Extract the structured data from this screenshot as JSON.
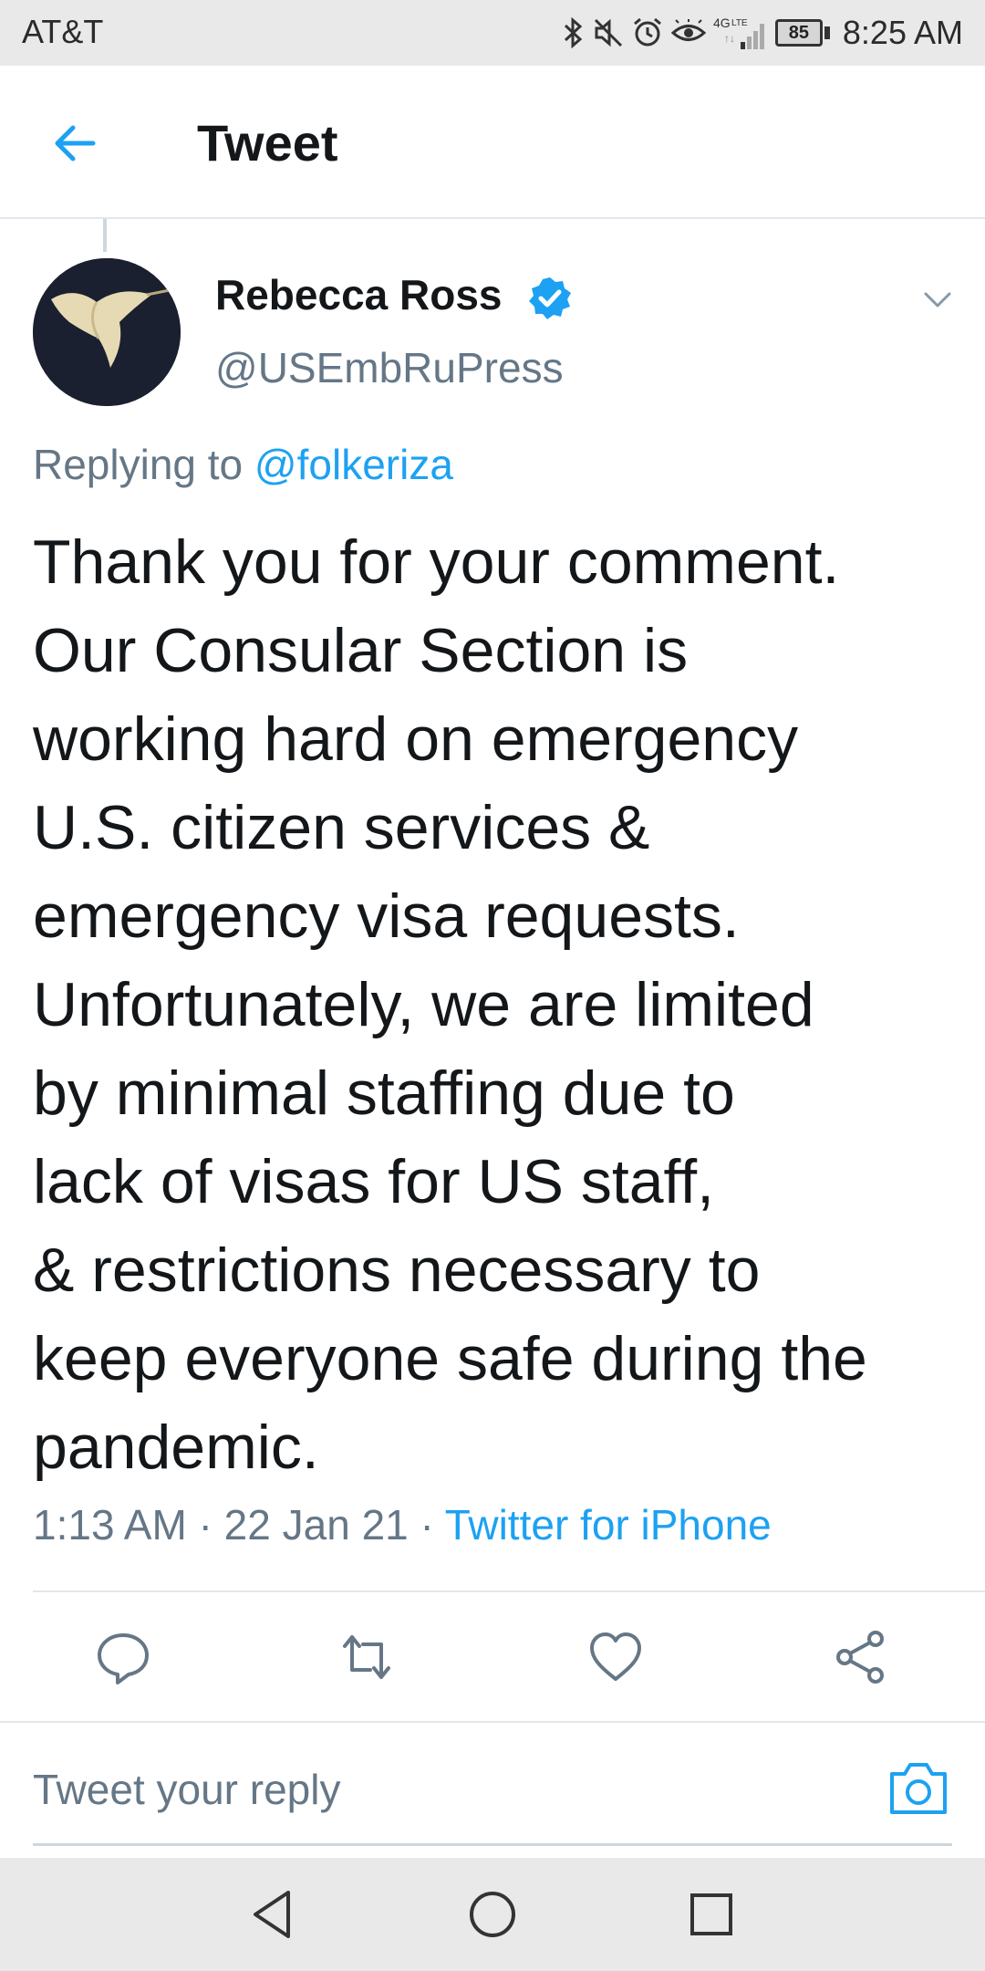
{
  "status_bar": {
    "carrier": "AT&T",
    "network": "4G LTE",
    "battery": "85",
    "time": "8:25 AM",
    "icons": [
      "bluetooth-icon",
      "mute-icon",
      "alarm-icon",
      "eye-icon",
      "signal-icon",
      "battery-icon"
    ]
  },
  "header": {
    "title": "Tweet",
    "back_icon": "back-arrow-icon"
  },
  "tweet": {
    "author_name": "Rebecca Ross",
    "author_handle": "@USEmbRuPress",
    "verified": true,
    "replying_label": "Replying to",
    "replying_to": "@folkeriza",
    "text_lines": [
      "Thank you for your comment.",
      "Our Consular Section is",
      "working hard on emergency",
      "U.S. citizen services &",
      "emergency visa requests.",
      "Unfortunately, we are limited",
      "by minimal staffing due to",
      "lack of visas for US staff,",
      "& restrictions necessary to",
      "keep everyone safe during the",
      "pandemic."
    ],
    "time": "1:13 AM",
    "date": "22 Jan 21",
    "separator": "·",
    "source": "Twitter for iPhone"
  },
  "actions": [
    "reply-icon",
    "retweet-icon",
    "like-icon",
    "share-icon"
  ],
  "reply_bar": {
    "placeholder": "Tweet your reply",
    "camera_icon": "camera-icon"
  },
  "nav_bar": [
    "back-triangle-icon",
    "home-circle-icon",
    "recents-square-icon"
  ],
  "colors": {
    "accent": "#1da1f2",
    "text": "#14171a",
    "muted": "#657786",
    "divider": "#e1e8ed",
    "system_bar": "#e9e9ea"
  }
}
